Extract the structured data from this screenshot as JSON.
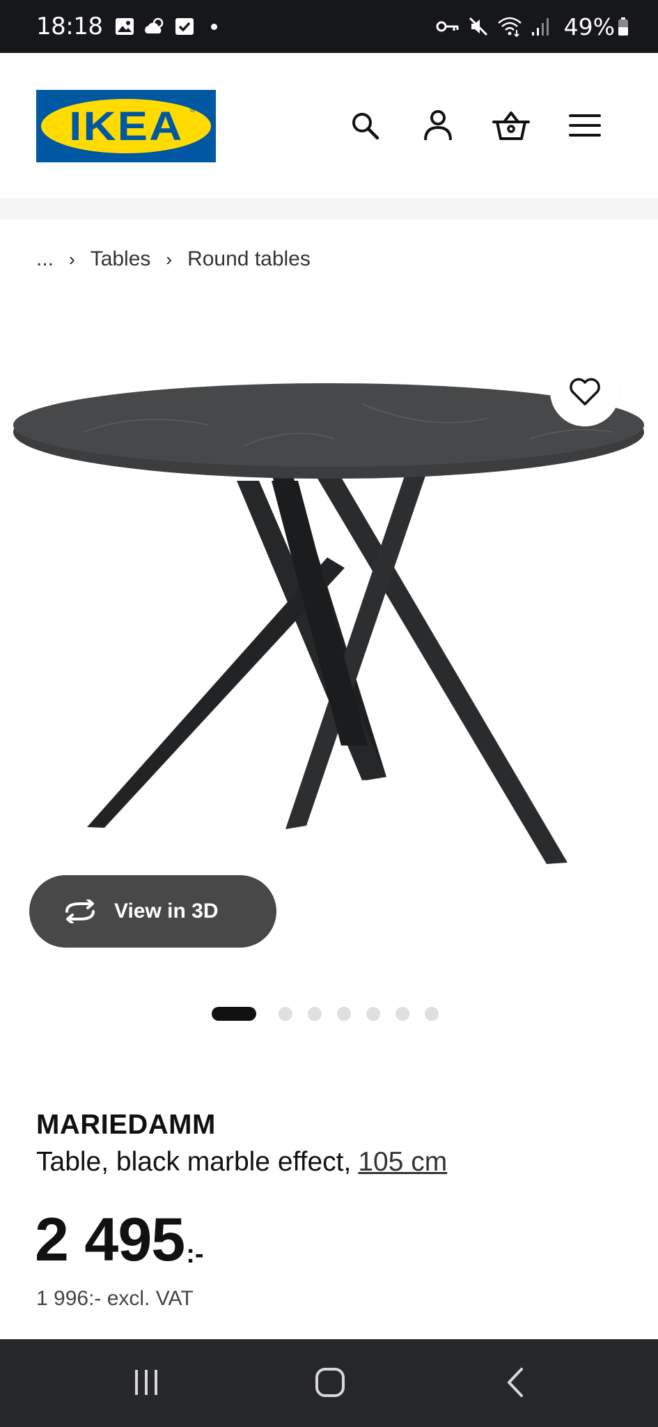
{
  "status_bar": {
    "time": "18:18",
    "battery": "49%"
  },
  "header": {
    "logo_text": "IKEA",
    "logo_mark": "®",
    "icons": [
      "search-icon",
      "account-icon",
      "shopping-basket-icon",
      "menu-icon"
    ]
  },
  "breadcrumb": {
    "ellipsis": "...",
    "items": [
      "Tables",
      "Round tables"
    ],
    "separator": "›"
  },
  "gallery": {
    "view_3d_label": "View in 3D",
    "image_count": 7,
    "active_index": 0
  },
  "product": {
    "name": "MARIEDAMM",
    "description": "Table, black marble effect,",
    "size": "105 cm",
    "price": "2 495",
    "price_suffix": ":-",
    "price_excl_vat": "1 996:- excl. VAT"
  },
  "colors": {
    "status_bar_bg": "#16171b",
    "ikea_blue": "#0058a3",
    "ikea_yellow": "#ffdb00",
    "nav_bar_bg": "#26272b",
    "view_3d_bg": "#484848"
  }
}
